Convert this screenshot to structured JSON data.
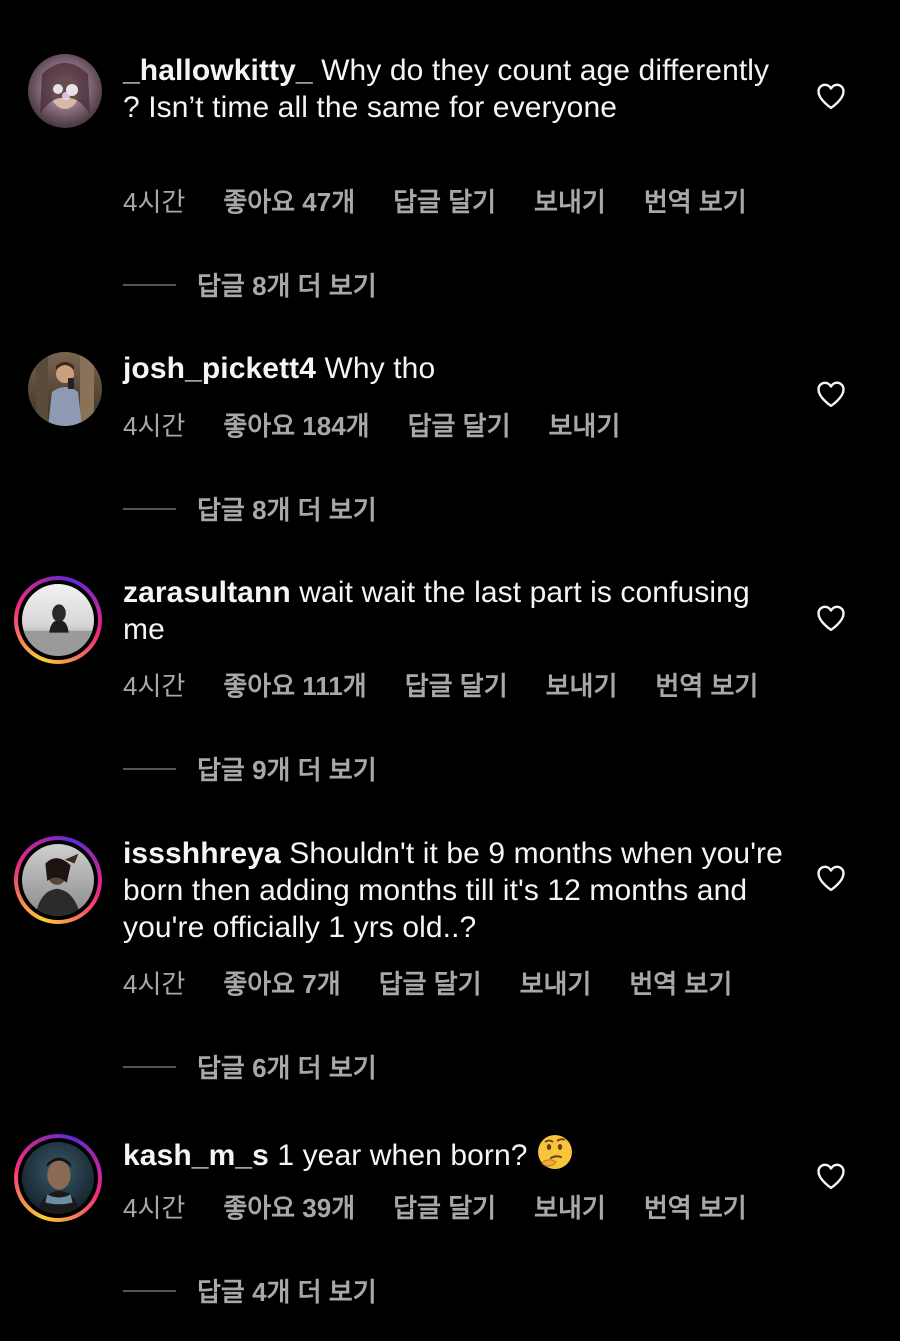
{
  "comments": [
    {
      "username": "_hallowkitty_",
      "text": "Why do they count age differently ? Isn’t time all the same for everyone",
      "time": "4시간",
      "likes": "좋아요 47개",
      "reply": "답글 달기",
      "send": "보내기",
      "translate": "번역 보기",
      "more_replies": "답글 8개 더 보기"
    },
    {
      "username": "josh_pickett4",
      "text": "Why tho",
      "time": "4시간",
      "likes": "좋아요 184개",
      "reply": "답글 달기",
      "send": "보내기",
      "more_replies": "답글 8개 더 보기"
    },
    {
      "username": "zarasultann",
      "text": "wait wait the last part is confusing me",
      "time": "4시간",
      "likes": "좋아요 111개",
      "reply": "답글 달기",
      "send": "보내기",
      "translate": "번역 보기",
      "more_replies": "답글 9개 더 보기"
    },
    {
      "username": "issshhreya",
      "text": "Shouldn't it be 9 months when you're born then adding months till it's 12 months and you're officially 1 yrs old..?",
      "time": "4시간",
      "likes": "좋아요 7개",
      "reply": "답글 달기",
      "send": "보내기",
      "translate": "번역 보기",
      "more_replies": "답글 6개 더 보기"
    },
    {
      "username": "kash_m_s",
      "text": "1 year when born?",
      "emoji": "thinking-face-icon",
      "time": "4시간",
      "likes": "좋아요 39개",
      "reply": "답글 달기",
      "send": "보내기",
      "translate": "번역 보기",
      "more_replies": "답글 4개 더 보기"
    }
  ],
  "colors": {
    "background": "#000000",
    "text": "#f5f5f5",
    "meta": "#a8a8a8"
  }
}
